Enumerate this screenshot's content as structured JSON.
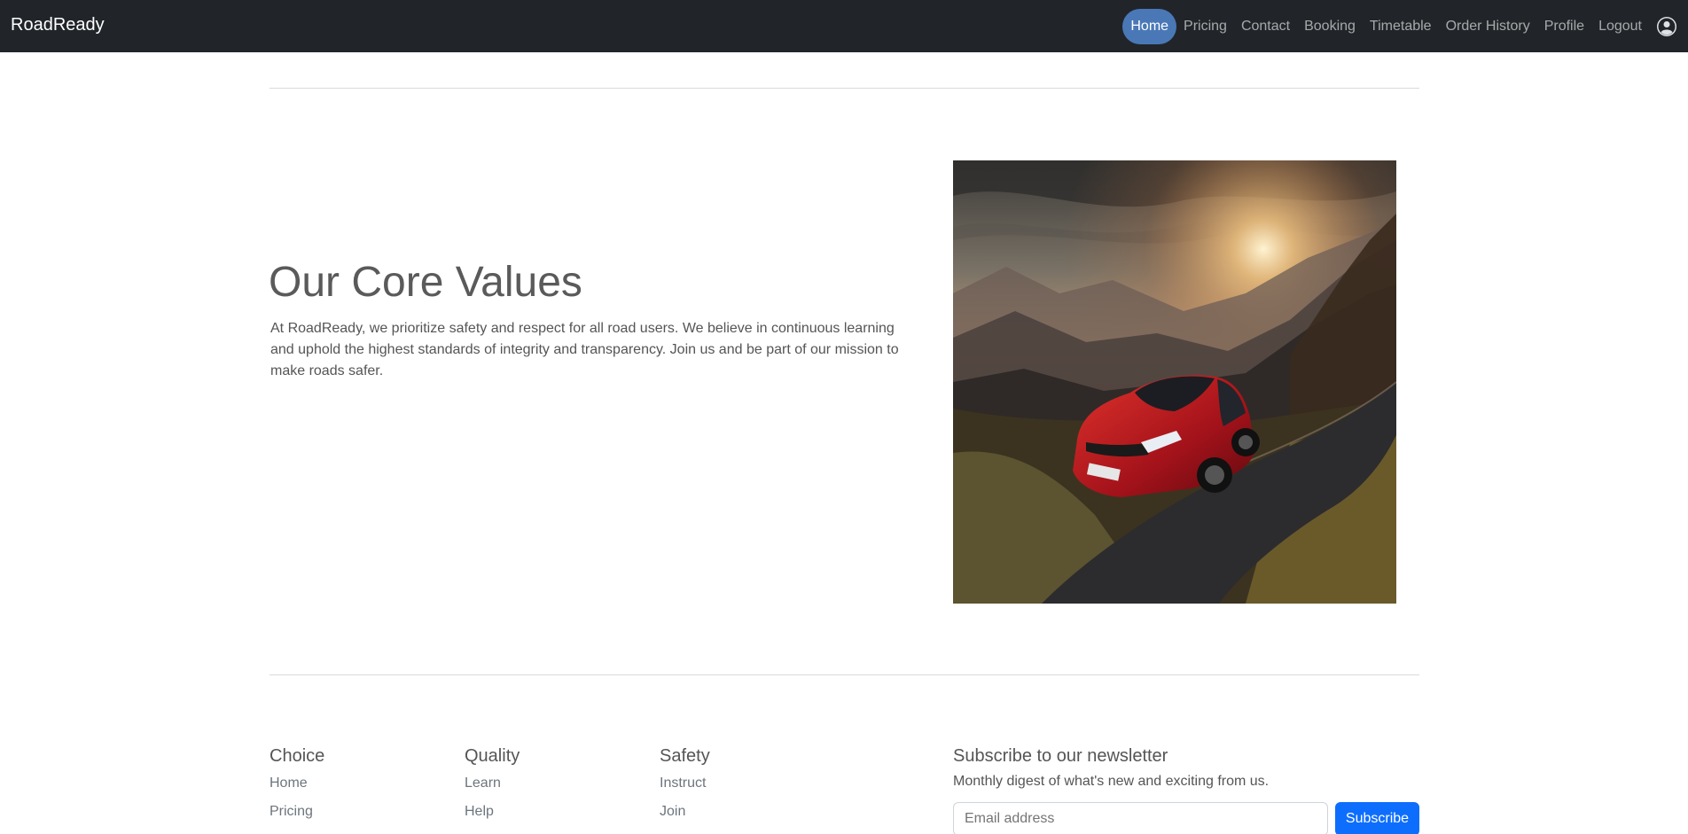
{
  "navbar": {
    "brand": "RoadReady",
    "links": [
      {
        "label": "Home",
        "active": true
      },
      {
        "label": "Pricing"
      },
      {
        "label": "Contact"
      },
      {
        "label": "Booking"
      },
      {
        "label": "Timetable"
      },
      {
        "label": "Order History"
      },
      {
        "label": "Profile"
      },
      {
        "label": "Logout"
      }
    ],
    "avatar_icon": "user-circle-icon"
  },
  "hero": {
    "title": "Our Core Values",
    "text": "At RoadReady, we prioritize safety and respect for all road users. We believe in continuous learning and uphold the highest standards of integrity and transparency. Join us and be part of our mission to make roads safer.",
    "image_icon": "red-car-mountain-road-image"
  },
  "footer": {
    "columns": [
      {
        "title": "Choice",
        "links": [
          "Home",
          "Pricing"
        ]
      },
      {
        "title": "Quality",
        "links": [
          "Learn",
          "Help"
        ]
      },
      {
        "title": "Safety",
        "links": [
          "Instruct",
          "Join"
        ]
      }
    ],
    "newsletter": {
      "title": "Subscribe to our newsletter",
      "text": "Monthly digest of what's new and exciting from us.",
      "placeholder": "Email address",
      "button": "Subscribe"
    }
  },
  "colors": {
    "navbar_bg": "#212529",
    "active_pill": "#4a78b7",
    "primary": "#0d6efd"
  }
}
